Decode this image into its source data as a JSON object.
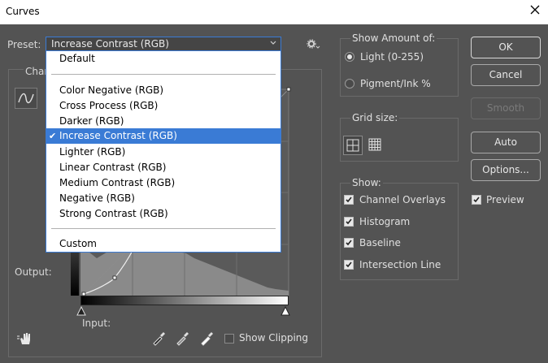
{
  "window": {
    "title": "Curves"
  },
  "preset": {
    "label": "Preset:",
    "selected": "Increase Contrast (RGB)"
  },
  "channel": {
    "label_partial": "Char"
  },
  "dropdown": {
    "items": [
      "Default",
      "Color Negative (RGB)",
      "Cross Process (RGB)",
      "Darker (RGB)",
      "Increase Contrast (RGB)",
      "Lighter (RGB)",
      "Linear Contrast (RGB)",
      "Medium Contrast (RGB)",
      "Negative (RGB)",
      "Strong Contrast (RGB)",
      "Custom"
    ],
    "selected_index": 4
  },
  "graph": {
    "output_label": "Output:",
    "input_label": "Input:"
  },
  "bottom": {
    "show_clipping_label": "Show Clipping",
    "show_clipping_checked": false
  },
  "show_amount": {
    "title": "Show Amount of:",
    "light_label": "Light  (0-255)",
    "pigment_label": "Pigment/Ink %",
    "selected": "light"
  },
  "grid_size": {
    "title": "Grid size:",
    "selected": "simple"
  },
  "show": {
    "title": "Show:",
    "channel_overlays": "Channel Overlays",
    "histogram": "Histogram",
    "baseline": "Baseline",
    "intersection_line": "Intersection Line"
  },
  "buttons": {
    "ok": "OK",
    "cancel": "Cancel",
    "smooth": "Smooth",
    "auto": "Auto",
    "options": "Options..."
  },
  "preview": {
    "label": "Preview",
    "checked": true
  },
  "colors": {
    "background": "#535353",
    "accent": "#3a7bd5",
    "titlebar": "#ffffff"
  },
  "icons": [
    "close-icon",
    "chevron-down-icon",
    "gear-icon",
    "curve-tool-icon",
    "pencil-icon",
    "hand-tool-icon",
    "black-eyedropper-icon",
    "gray-eyedropper-icon",
    "white-eyedropper-icon",
    "grid-simple-icon",
    "grid-detailed-icon"
  ]
}
